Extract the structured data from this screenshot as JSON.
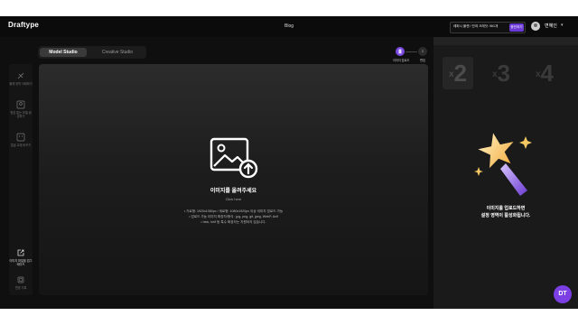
{
  "header": {
    "brand": "Draftype",
    "blog": "Blog",
    "credit_text": "레퍼시 플랜 / 잔여 크레딧: 961개",
    "charge_label": "충전하기",
    "username": "변혜인"
  },
  "tabs": [
    {
      "label": "Model Studio",
      "active": true
    },
    {
      "label": "Creative Studio",
      "active": false
    }
  ],
  "steps": [
    {
      "num": "1",
      "label": "이미지 업로드"
    },
    {
      "num": "2",
      "label": "편집"
    }
  ],
  "sidebar": {
    "items": [
      {
        "label": "물체 영역 삭제하기"
      },
      {
        "label": "원본 없는 모델 생성하기"
      },
      {
        "label": "얼굴 교체 바꾸기"
      },
      {
        "label": "이미지 파일을 업그레이드"
      },
      {
        "label": "변경 기록"
      }
    ]
  },
  "upload": {
    "title": "이미지를 올려주세요",
    "subtitle": "Click here",
    "notes": [
      "• 가로형: 1920x1080px / 세로형: 1080x1920px 이상 이미지 업로드 가능",
      "• 업로드 가능 이미지 확장자/형식 : jpg, png, gif, jpeg, WebP, Avif",
      "• heic, heif 등 특수 확장자는 지원하지 않습니다."
    ]
  },
  "right_panel": {
    "counts": [
      "2",
      "3",
      "4"
    ],
    "count_prefix": "x",
    "message_line1": "이미지를 업로드하면",
    "message_line2": "설정 영역이 활성화됩니다."
  },
  "badge": "DT",
  "colors": {
    "accent": "#7b4ae0",
    "background": "#0f0f0f"
  }
}
